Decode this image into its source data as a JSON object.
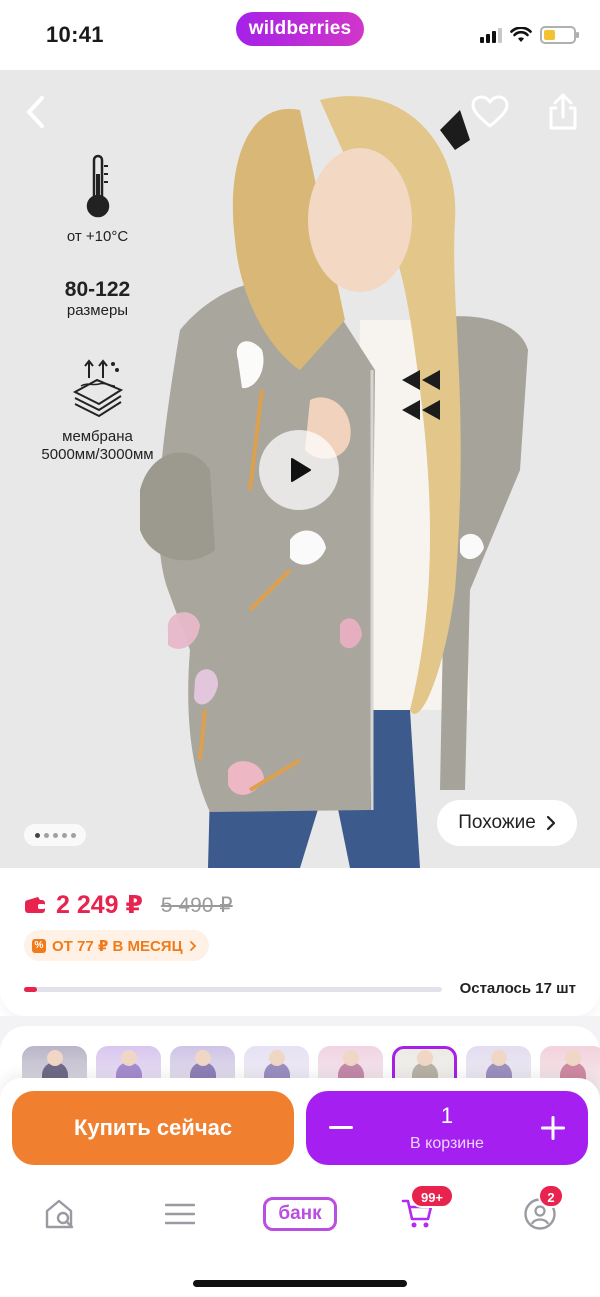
{
  "status_bar": {
    "time": "10:41",
    "brand": "wildberries",
    "battery_color": "#f2c230",
    "icons": [
      "signal-icon",
      "wifi-icon",
      "battery-icon"
    ]
  },
  "hero": {
    "features": [
      {
        "icon": "thermometer-icon",
        "text": "от +10°C"
      },
      {
        "title": "80-122",
        "text": "размеры"
      },
      {
        "icon": "membrane-icon",
        "text_line1": "мембрана",
        "text_line2": "5000мм/3000мм"
      }
    ],
    "similar_label": "Похожие",
    "gallery_pages": 5,
    "gallery_current": 1
  },
  "price": {
    "current": "2 249 ₽",
    "old": "5 490 ₽",
    "installment": "ОТ 77 ₽ В МЕСЯЦ",
    "stock_label": "Осталось 17 шт",
    "stock_level": 0.03,
    "accent": "#e8234d"
  },
  "variants": {
    "count": 8,
    "selected_index": 5
  },
  "actions": {
    "buy_label": "Купить сейчас",
    "quantity": "1",
    "in_cart_label": "В корзине",
    "buy_color": "#f0802f",
    "cart_color": "#a51ff0"
  },
  "nav": {
    "bank_label": "банк",
    "cart_badge": "99+",
    "profile_badge": "2"
  }
}
